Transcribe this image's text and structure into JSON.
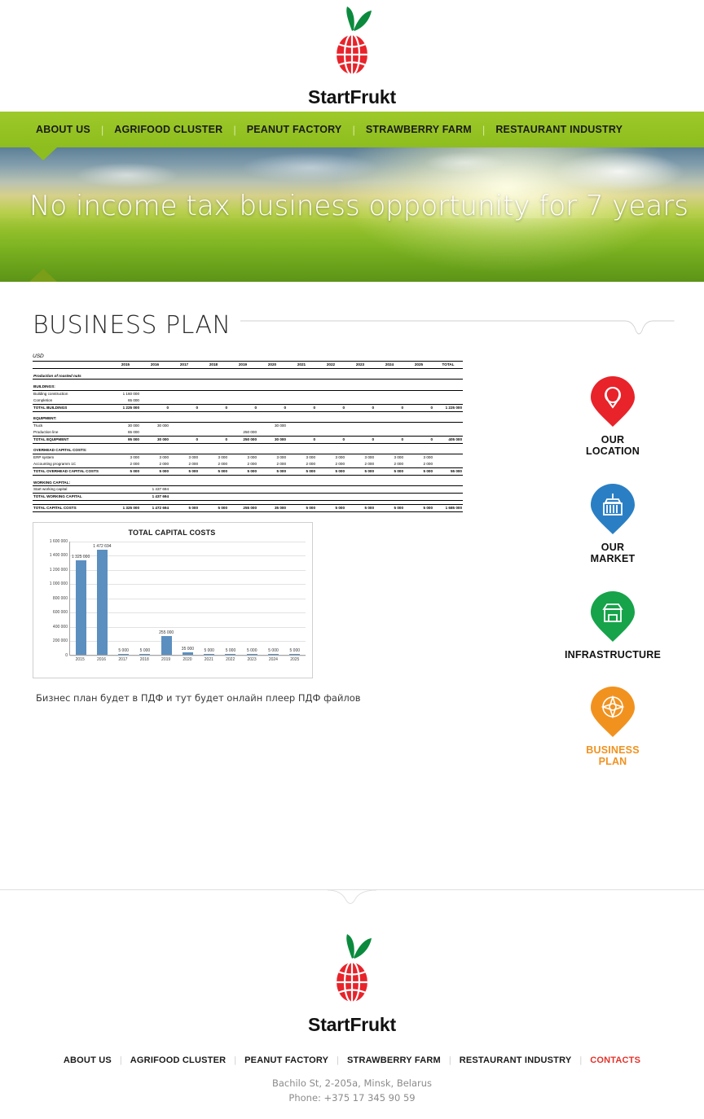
{
  "brand": {
    "name": "StartFrukt",
    "logo_icon": "apple-globe-logo",
    "leaf_color": "#0b8a3d",
    "globe_color": "#e8232a"
  },
  "nav": {
    "background": "#93c226",
    "items": [
      {
        "label": "ABOUT US",
        "name": "about-us"
      },
      {
        "label": "AGRIFOOD CLUSTER",
        "name": "agrifood-cluster"
      },
      {
        "label": "PEANUT FACTORY",
        "name": "peanut-factory"
      },
      {
        "label": "STRAWBERRY FARM",
        "name": "strawberry-farm"
      },
      {
        "label": "RESTAURANT INDUSTRY",
        "name": "restaurant-industry"
      }
    ],
    "separator": "|"
  },
  "hero": {
    "title": "No income tax business opportunity for 7 years"
  },
  "section": {
    "title": "BUSINESS PLAN"
  },
  "sheet": {
    "currency": "USD",
    "years": [
      "2015",
      "2016",
      "2017",
      "2018",
      "2019",
      "2020",
      "2021",
      "2022",
      "2023",
      "2024",
      "2025"
    ],
    "total_header": "TOTAL",
    "subtitle": "Production of roasted nuts",
    "groups": [
      {
        "heading": "BUILDINGS:",
        "rows": [
          {
            "label": "Building construction",
            "values": [
              "1 160 000",
              "",
              "",
              "",
              "",
              "",
              "",
              "",
              "",
              "",
              ""
            ],
            "total": ""
          },
          {
            "label": "Completion",
            "values": [
              "65 000",
              "",
              "",
              "",
              "",
              "",
              "",
              "",
              "",
              "",
              ""
            ],
            "total": ""
          }
        ],
        "total_row": {
          "label": "TOTAL BUILDINGS",
          "values": [
            "1 225 000",
            "0",
            "0",
            "0",
            "0",
            "0",
            "0",
            "0",
            "0",
            "0",
            "0"
          ],
          "total": "1 225 000"
        }
      },
      {
        "heading": "EQUIPMENT:",
        "rows": [
          {
            "label": "Truck",
            "values": [
              "30 000",
              "30 000",
              "",
              "",
              "",
              "30 000",
              "",
              "",
              "",
              "",
              ""
            ],
            "total": ""
          },
          {
            "label": "Production line",
            "values": [
              "65 000",
              "",
              "",
              "",
              "250 000",
              "",
              "",
              "",
              "",
              "",
              ""
            ],
            "total": ""
          }
        ],
        "total_row": {
          "label": "TOTAL EQUIPMENT",
          "values": [
            "95 000",
            "30 000",
            "0",
            "0",
            "250 000",
            "30 000",
            "0",
            "0",
            "0",
            "0",
            "0"
          ],
          "total": "405 000"
        }
      },
      {
        "heading": "OVERHEAD CAPITAL COSTS:",
        "rows": [
          {
            "label": "ERP system",
            "values": [
              "3 000",
              "3 000",
              "3 000",
              "3 000",
              "3 000",
              "3 000",
              "3 000",
              "3 000",
              "3 000",
              "3 000",
              "3 000"
            ],
            "total": ""
          },
          {
            "label": "Accounting programm 1C",
            "values": [
              "2 000",
              "2 000",
              "2 000",
              "2 000",
              "2 000",
              "2 000",
              "2 000",
              "2 000",
              "2 000",
              "2 000",
              "2 000"
            ],
            "total": ""
          }
        ],
        "total_row": {
          "label": "TOTAL OVERHEAD CAPITAL COSTS",
          "values": [
            "5 000",
            "5 000",
            "5 000",
            "5 000",
            "5 000",
            "5 000",
            "5 000",
            "5 000",
            "5 000",
            "5 000",
            "5 000"
          ],
          "total": "55 000"
        }
      },
      {
        "heading": "WORKING CAPITAL:",
        "rows": [
          {
            "label": "Start working capital",
            "values": [
              "",
              "1 437 694",
              "",
              "",
              "",
              "",
              "",
              "",
              "",
              "",
              ""
            ],
            "total": ""
          }
        ],
        "total_row": {
          "label": "TOTAL WORKING CAPITAL",
          "values": [
            "",
            "1 437 694",
            "",
            "",
            "",
            "",
            "",
            "",
            "",
            "",
            ""
          ],
          "total": ""
        }
      }
    ],
    "grand_total": {
      "label": "TOTAL CAPITAL COSTS",
      "values": [
        "1 325 000",
        "1 472 694",
        "5 000",
        "5 000",
        "255 000",
        "35 000",
        "5 000",
        "5 000",
        "5 000",
        "5 000",
        "5 000"
      ],
      "total": "1 685 000"
    }
  },
  "chart_data": {
    "type": "bar",
    "title": "TOTAL CAPITAL COSTS",
    "categories": [
      "2015",
      "2016",
      "2017",
      "2018",
      "2019",
      "2020",
      "2021",
      "2022",
      "2023",
      "2024",
      "2025"
    ],
    "values": [
      1325000,
      1472694,
      5000,
      5000,
      255000,
      35000,
      5000,
      5000,
      5000,
      5000,
      5000
    ],
    "data_labels": [
      "1 325 000",
      "1 472 694",
      "5 000",
      "5 000",
      "255 000",
      "35 000",
      "5 000",
      "5 000",
      "5 000",
      "5 000",
      "5 000"
    ],
    "ylim": [
      0,
      1600000
    ],
    "yticks": [
      0,
      200000,
      400000,
      600000,
      800000,
      1000000,
      1200000,
      1400000,
      1600000
    ],
    "ytick_labels": [
      "0",
      "200 000",
      "400 000",
      "600 000",
      "800 000",
      "1 000 000",
      "1 200 000",
      "1 400 000",
      "1 600 000"
    ],
    "xlabel": "",
    "ylabel": "",
    "grid": true,
    "legend": false,
    "series_color": "#5b8fc0"
  },
  "note": "Бизнес план будет в ПДФ и тут будет онлайн плеер ПДФ файлов",
  "pins": [
    {
      "name": "our-location",
      "icon": "map-pin-icon",
      "label_line1": "OUR",
      "label_line2": "LOCATION",
      "color": "#e8232a",
      "label_color": "#111111"
    },
    {
      "name": "our-market",
      "icon": "shipping-container-icon",
      "label_line1": "OUR",
      "label_line2": "MARKET",
      "color": "#2a7fc4",
      "label_color": "#111111"
    },
    {
      "name": "infrastructure",
      "icon": "storefront-icon",
      "label_line1": "INFRASTRUCTURE",
      "label_line2": "",
      "color": "#16a34a",
      "label_color": "#111111"
    },
    {
      "name": "business-plan",
      "icon": "compass-icon",
      "label_line1": "BUSINESS",
      "label_line2": "PLAN",
      "color": "#f1921f",
      "label_color": "#f1921f"
    }
  ],
  "footer": {
    "nav": [
      {
        "label": "ABOUT US",
        "name": "about-us",
        "highlight": false
      },
      {
        "label": "AGRIFOOD CLUSTER",
        "name": "agrifood-cluster",
        "highlight": false
      },
      {
        "label": "PEANUT FACTORY",
        "name": "peanut-factory",
        "highlight": false
      },
      {
        "label": "STRAWBERRY FARM",
        "name": "strawberry-farm",
        "highlight": false
      },
      {
        "label": "RESTAURANT INDUSTRY",
        "name": "restaurant-industry",
        "highlight": false
      },
      {
        "label": "CONTACTS",
        "name": "contacts",
        "highlight": true
      }
    ],
    "separator": "|",
    "address": "Bachilo St, 2-205a, Minsk, Belarus",
    "phone": "Phone: +375 17 345 90 59"
  }
}
